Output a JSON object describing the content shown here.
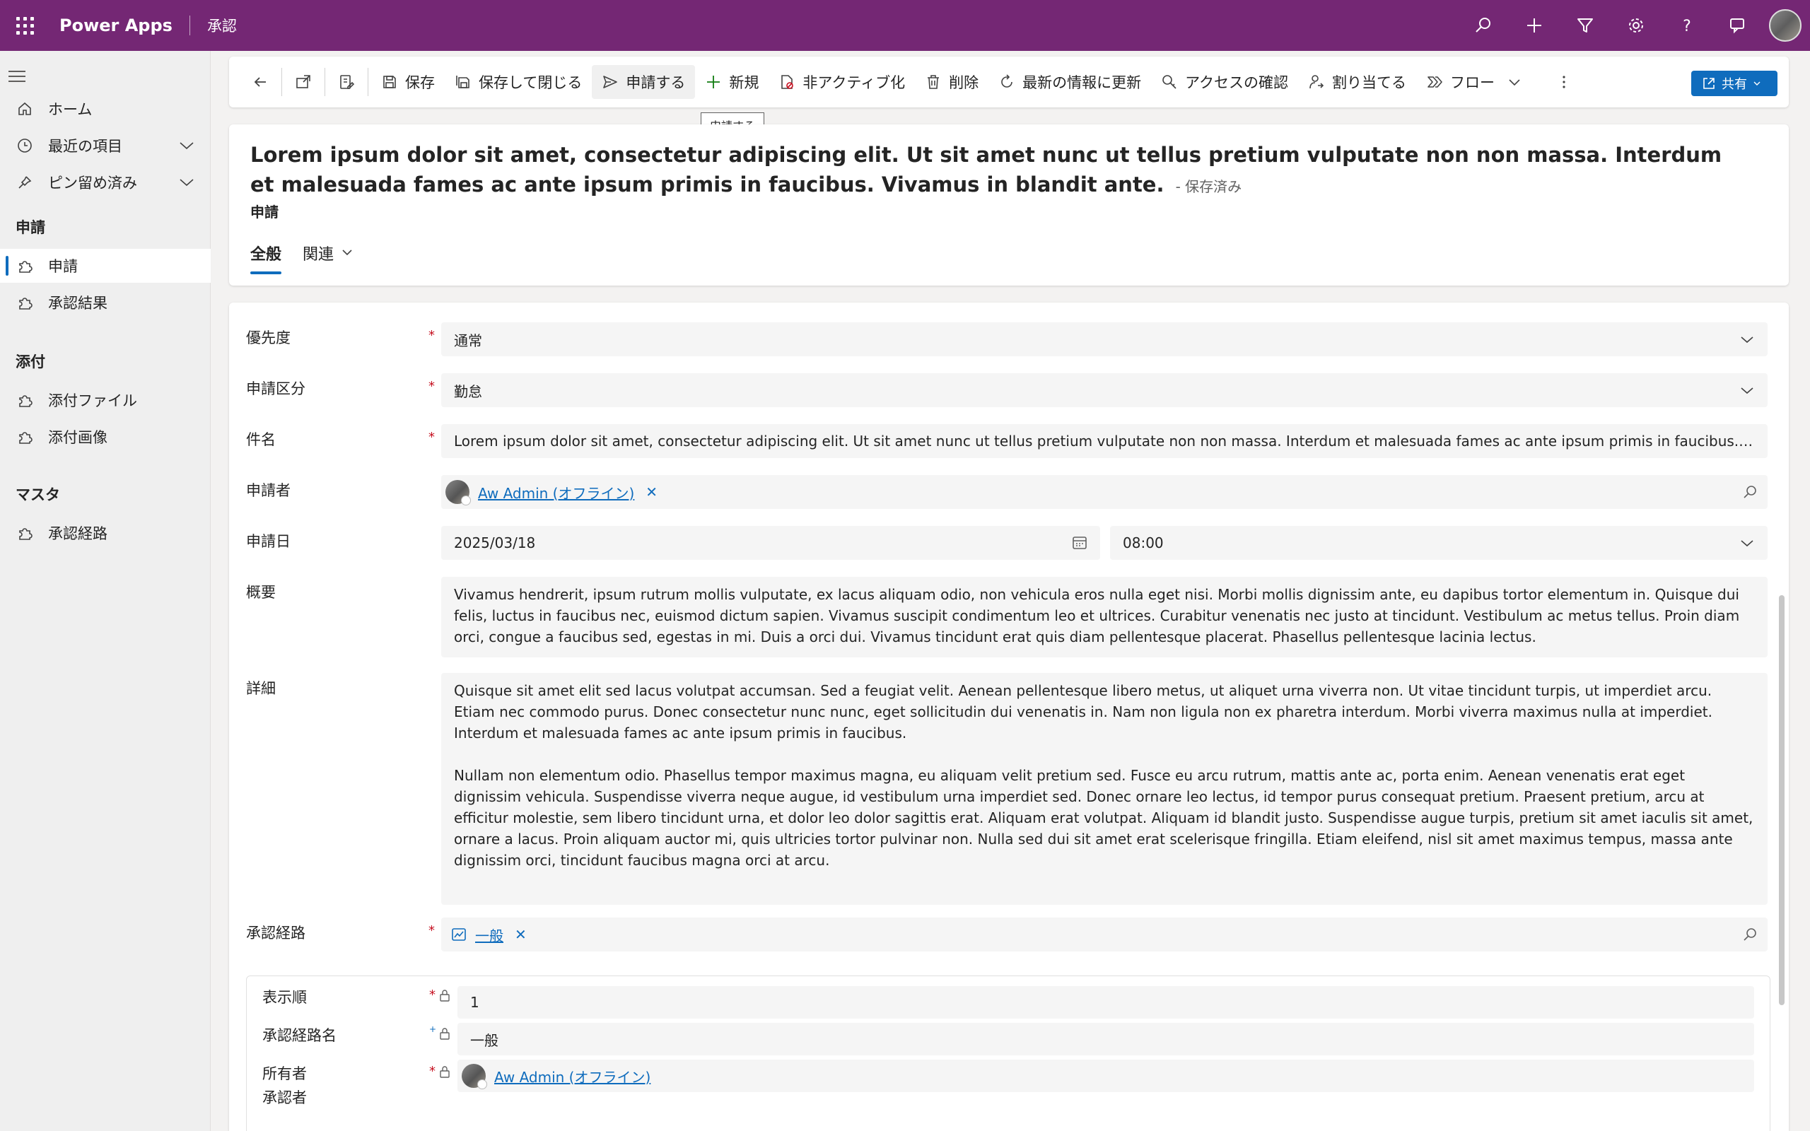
{
  "topbar": {
    "brand": "Power Apps",
    "app": "承認"
  },
  "sidebar": {
    "home": "ホーム",
    "recent": "最近の項目",
    "pinned": "ピン留め済み",
    "group1": "申請",
    "item_request": "申請",
    "item_result": "承認結果",
    "group2": "添付",
    "item_file": "添付ファイル",
    "item_image": "添付画像",
    "group3": "マスタ",
    "item_route": "承認経路"
  },
  "commands": {
    "save": "保存",
    "save_close": "保存して閉じる",
    "submit": "申請する",
    "new": "新規",
    "deactivate": "非アクティブ化",
    "delete": "削除",
    "refresh": "最新の情報に更新",
    "check_access": "アクセスの確認",
    "assign": "割り当てる",
    "flow": "フロー",
    "share": "共有"
  },
  "tooltip": "申請する",
  "header": {
    "title": "Lorem ipsum dolor sit amet, consectetur adipiscing elit. Ut sit amet nunc ut tellus pretium vulputate non non massa. Interdum et malesuada fames ac ante ipsum primis in faucibus. Vivamus in blandit ante.",
    "saved": "- 保存済み",
    "entity": "申請",
    "tab_general": "全般",
    "tab_related": "関連"
  },
  "form": {
    "priority_label": "優先度",
    "priority_value": "通常",
    "category_label": "申請区分",
    "category_value": "勤怠",
    "subject_label": "件名",
    "subject_value": "Lorem ipsum dolor sit amet, consectetur adipiscing elit. Ut sit amet nunc ut tellus pretium vulputate non non massa. Interdum et malesuada fames ac ante ipsum primis in faucibus. Vivamus in blandit ante.",
    "applicant_label": "申請者",
    "applicant_value": "Aw Admin (オフライン)",
    "date_label": "申請日",
    "date_value": "2025/03/18",
    "time_value": "08:00",
    "summary_label": "概要",
    "summary_value": "Vivamus hendrerit, ipsum rutrum mollis vulputate, ex lacus aliquam odio, non vehicula eros nulla eget nisi. Morbi mollis dignissim ante, eu dapibus tortor elementum in. Quisque dui felis, luctus in faucibus nec, euismod dictum sapien. Vivamus suscipit condimentum leo et ultrices. Curabitur venenatis nec justo at tincidunt. Vestibulum ac metus tellus. Proin diam orci, congue a faucibus sed, egestas in mi. Duis a orci dui. Vivamus tincidunt erat quis diam pellentesque placerat. Phasellus pellentesque lacinia lectus.",
    "detail_label": "詳細",
    "detail_p1": "Quisque sit amet elit sed lacus volutpat accumsan. Sed a feugiat velit. Aenean pellentesque libero metus, ut aliquet urna viverra non. Ut vitae tincidunt turpis, ut imperdiet arcu. Etiam nec commodo purus. Donec consectetur nunc nunc, eget sollicitudin dui venenatis in. Nam non ligula non ex pharetra interdum. Morbi viverra maximus nulla at imperdiet. Interdum et malesuada fames ac ante ipsum primis in faucibus.",
    "detail_p2": "Nullam non elementum odio. Phasellus tempor maximus magna, eu aliquam velit pretium sed. Fusce eu arcu rutrum, mattis ante ac, porta enim. Aenean venenatis erat eget dignissim vehicula. Suspendisse viverra neque augue, id vestibulum urna imperdiet sed. Donec ornare leo lectus, id tempor purus consequat pretium. Praesent pretium, arcu at efficitur molestie, sem libero tincidunt urna, et dolor leo dolor sagittis erat. Aliquam erat volutpat. Aliquam id blandit justo. Suspendisse augue turpis, pretium sit amet iaculis sit amet, ornare a lacus. Proin aliquam auctor mi, quis ultricies tortor pulvinar non. Nulla sed dui sit amet erat scelerisque fringilla. Etiam eleifend, nisl sit amet maximus tempus, massa ante dignissim orci, tincidunt faucibus magna orci at arcu.",
    "route_label": "承認経路",
    "route_value": "一般"
  },
  "route_card": {
    "order_label": "表示順",
    "order_value": "1",
    "name_label": "承認経路名",
    "name_value": "一般",
    "owner_label": "所有者",
    "owner_value": "Aw Admin (オフライン)",
    "approver_label": "承認者"
  },
  "colors": {
    "topbar": "#742774",
    "accent": "#0f6cbd",
    "required": "#c50f1f"
  }
}
